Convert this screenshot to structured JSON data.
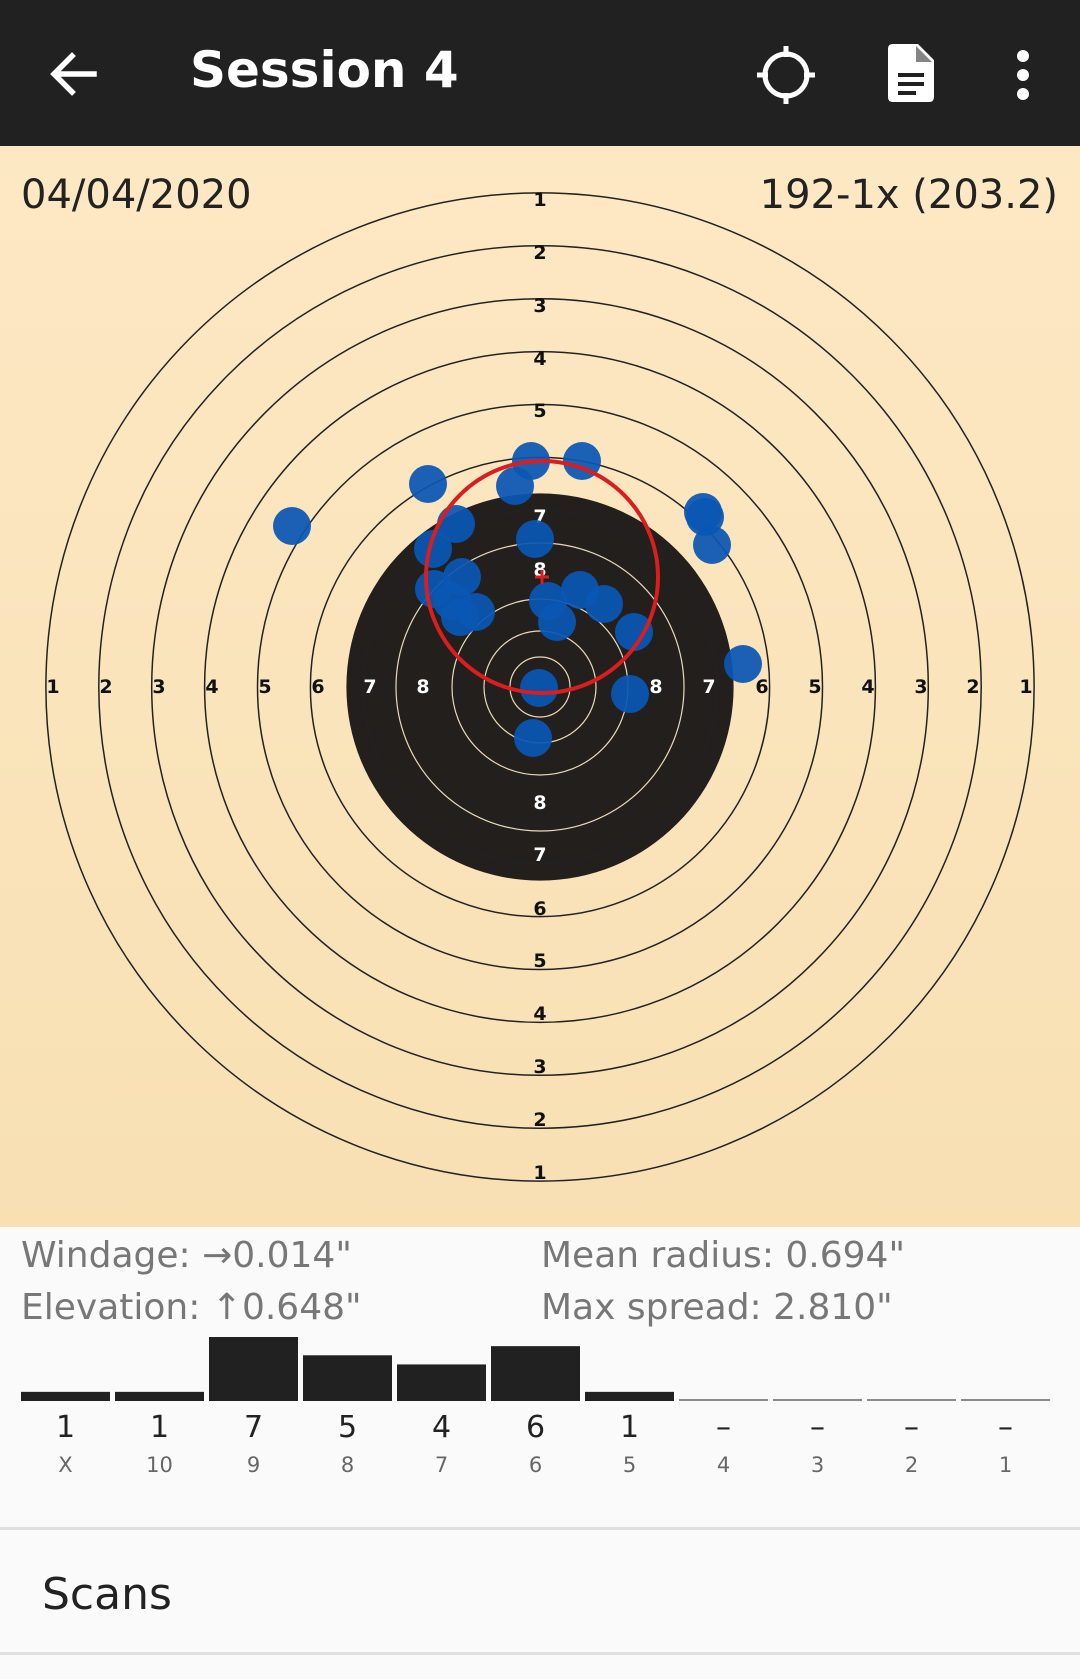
{
  "appbar": {
    "title": "Session 4",
    "icons": [
      "back-arrow-icon",
      "crosshair-icon",
      "document-icon",
      "more-vert-icon"
    ]
  },
  "target": {
    "date": "04/04/2020",
    "score": "192-1x (203.2)",
    "ring_labels_vertical_top": [
      "1",
      "2",
      "3",
      "4",
      "5",
      "7",
      "8"
    ],
    "ring_labels_vertical_bottom": [
      "8",
      "7",
      "6",
      "5",
      "4",
      "3",
      "2",
      "1"
    ],
    "ring_labels_horizontal": [
      "1",
      "2",
      "3",
      "4",
      "5",
      "6",
      "7",
      "8",
      "8",
      "7",
      "6",
      "5",
      "4",
      "3",
      "2",
      "1"
    ],
    "colors": {
      "paper": "#fde8c4",
      "black": "#221f1c",
      "shot": "#0a56b4",
      "group_circle": "#d81e1e"
    }
  },
  "stats": {
    "windage": "Windage: →0.014\"",
    "elevation": "Elevation: ↑0.648\"",
    "mean_radius": "Mean radius: 0.694\"",
    "max_spread": "Max spread: 2.810\""
  },
  "histogram": {
    "bins": [
      {
        "ring": "X",
        "count": 1,
        "count_label": "1"
      },
      {
        "ring": "10",
        "count": 1,
        "count_label": "1"
      },
      {
        "ring": "9",
        "count": 7,
        "count_label": "7"
      },
      {
        "ring": "8",
        "count": 5,
        "count_label": "5"
      },
      {
        "ring": "7",
        "count": 4,
        "count_label": "4"
      },
      {
        "ring": "6",
        "count": 6,
        "count_label": "6"
      },
      {
        "ring": "5",
        "count": 1,
        "count_label": "1"
      },
      {
        "ring": "4",
        "count": 0,
        "count_label": "–"
      },
      {
        "ring": "3",
        "count": 0,
        "count_label": "–"
      },
      {
        "ring": "2",
        "count": 0,
        "count_label": "–"
      },
      {
        "ring": "1",
        "count": 0,
        "count_label": "–"
      }
    ]
  },
  "scans": {
    "label": "Scans"
  }
}
